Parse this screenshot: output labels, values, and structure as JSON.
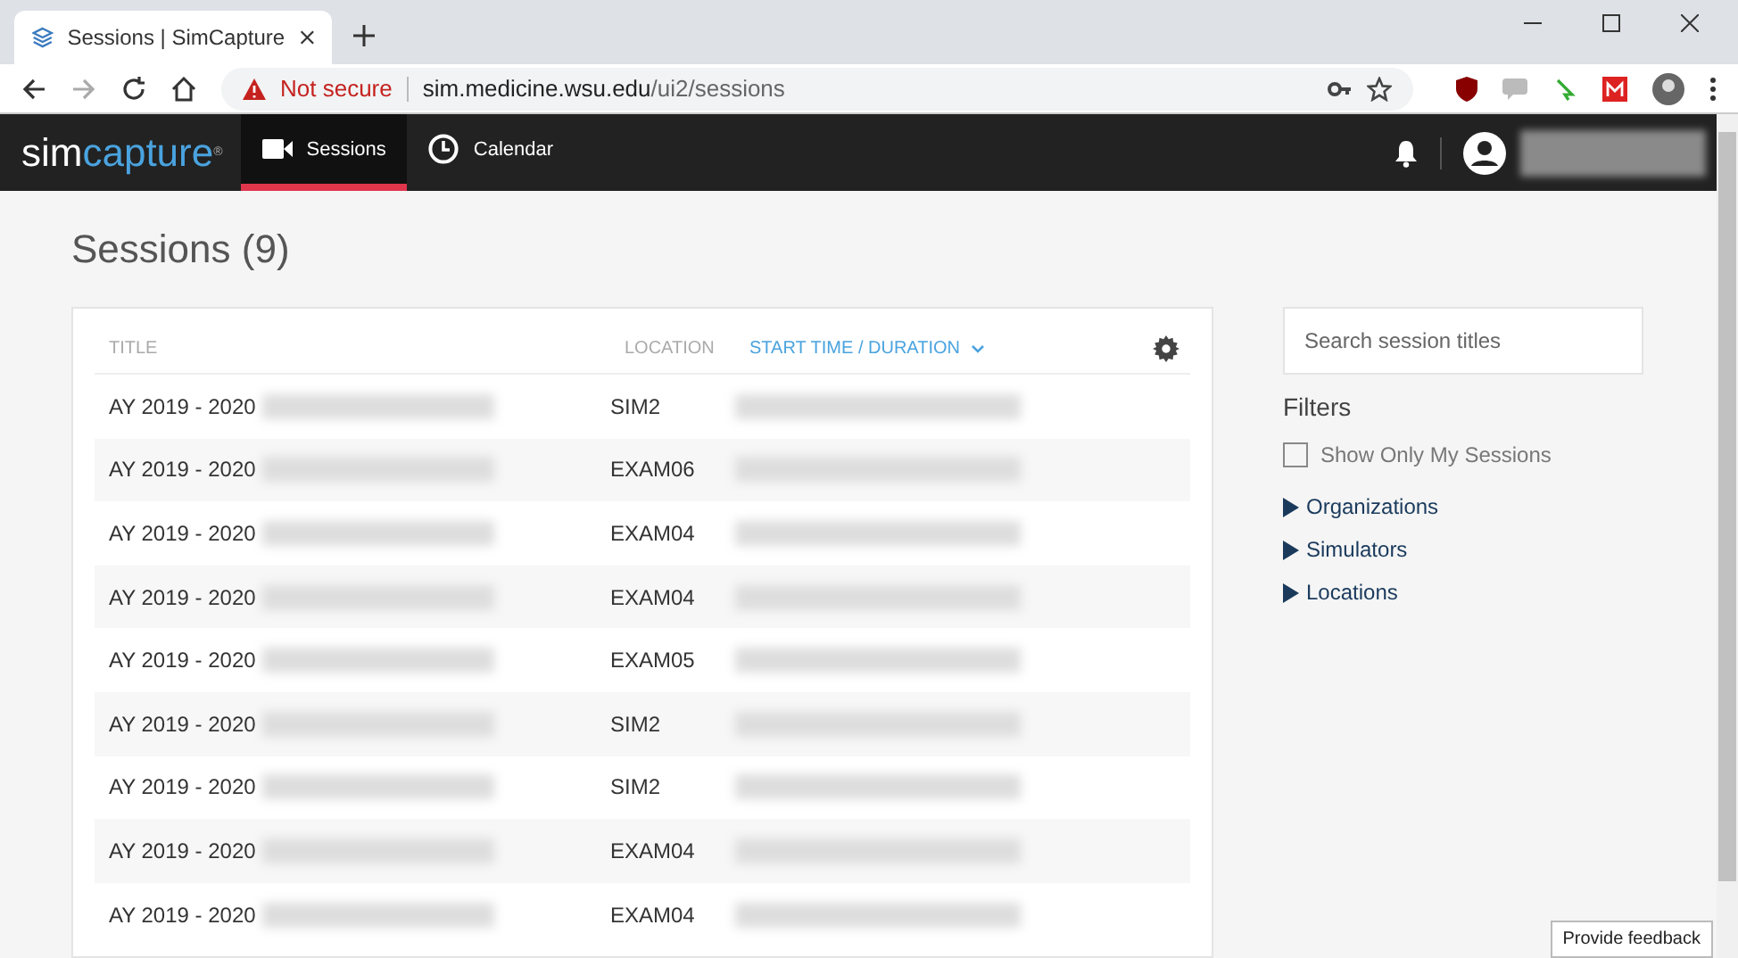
{
  "browser": {
    "tab_title": "Sessions | SimCapture",
    "security": "Not secure",
    "url_host": "sim.medicine.wsu.edu",
    "url_path": "/ui2/sessions"
  },
  "app": {
    "logo_left": "sim",
    "logo_right": "capture",
    "logo_mark": "®",
    "nav": [
      {
        "label": "Sessions",
        "selected": true
      },
      {
        "label": "Calendar",
        "selected": false
      }
    ]
  },
  "page_title": "Sessions (9)",
  "table": {
    "columns": [
      {
        "label": "TITLE",
        "sorted": false
      },
      {
        "label": "LOCATION",
        "sorted": false
      },
      {
        "label": "START TIME / DURATION",
        "sorted": true
      }
    ],
    "rows": [
      {
        "title": "AY 2019 - 2020",
        "location": "SIM2"
      },
      {
        "title": "AY 2019 - 2020",
        "location": "EXAM06"
      },
      {
        "title": "AY 2019 - 2020",
        "location": "EXAM04"
      },
      {
        "title": "AY 2019 - 2020",
        "location": "EXAM04"
      },
      {
        "title": "AY 2019 - 2020",
        "location": "EXAM05"
      },
      {
        "title": "AY 2019 - 2020",
        "location": "SIM2"
      },
      {
        "title": "AY 2019 - 2020",
        "location": "SIM2"
      },
      {
        "title": "AY 2019 - 2020",
        "location": "EXAM04"
      },
      {
        "title": "AY 2019 - 2020",
        "location": "EXAM04"
      }
    ]
  },
  "search": {
    "placeholder": "Search session titles"
  },
  "filters": {
    "heading": "Filters",
    "only_mine": {
      "label": "Show Only My Sessions",
      "checked": false
    },
    "groups": [
      {
        "label": "Organizations",
        "expanded": false
      },
      {
        "label": "Simulators",
        "expanded": false
      },
      {
        "label": "Locations",
        "expanded": false
      }
    ]
  },
  "feedback": "Provide feedback"
}
